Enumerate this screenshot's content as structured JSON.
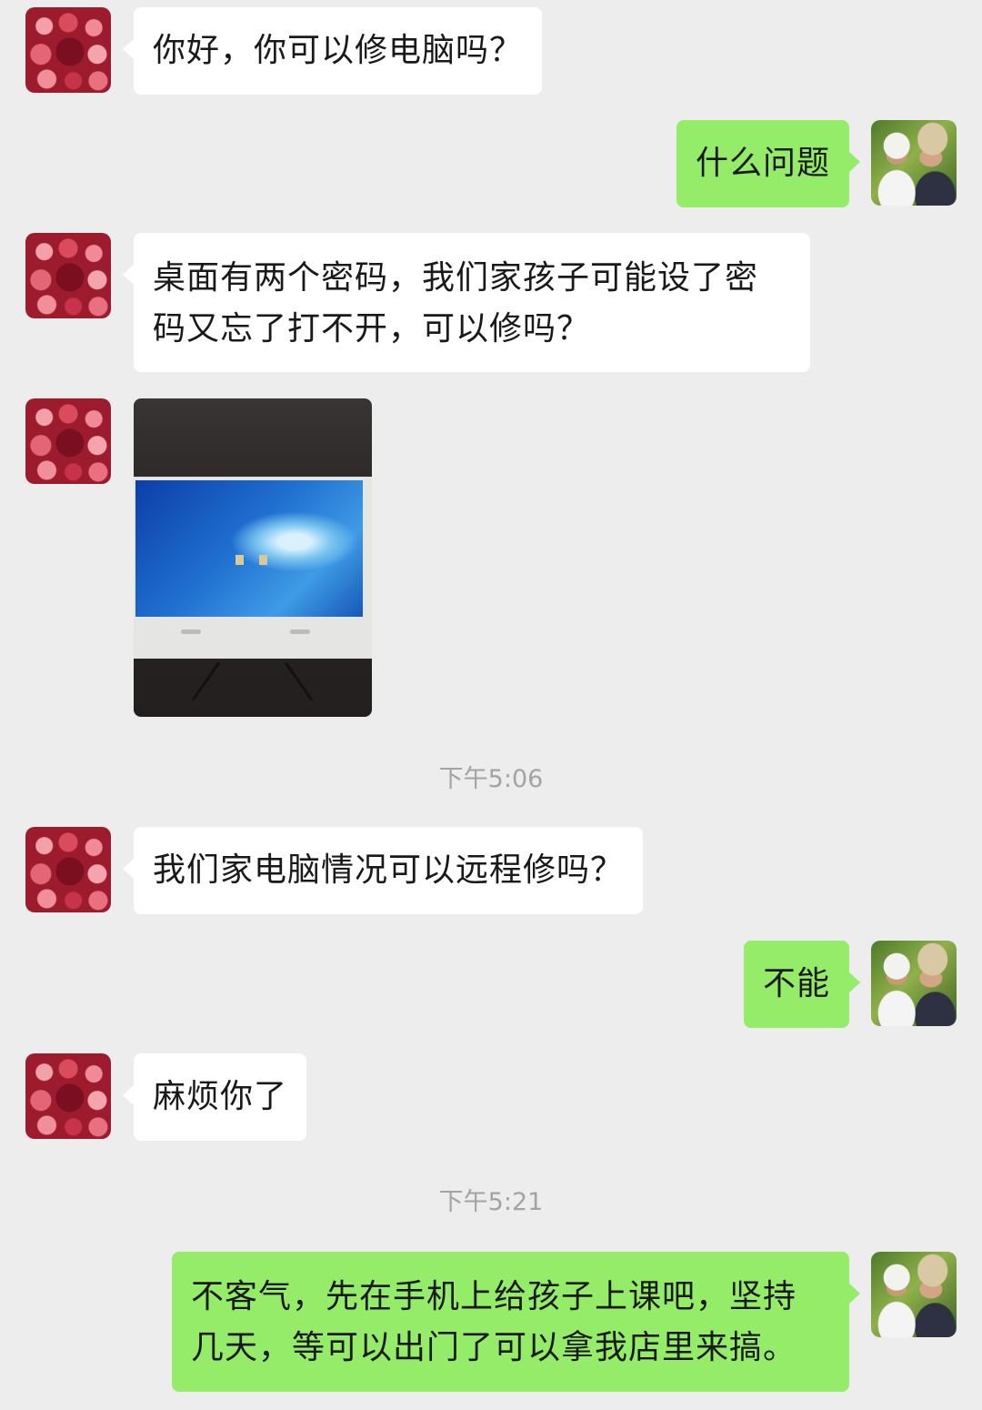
{
  "messages": [
    {
      "side": "in",
      "lines": [
        "你好，你可以修电脑吗？"
      ]
    },
    {
      "side": "out",
      "lines": [
        "什么问题"
      ]
    },
    {
      "side": "in",
      "lines": [
        "桌面有两个密码，我们家孩子可能设了密",
        "码又忘了打不开，可以修吗？"
      ]
    },
    {
      "side": "in",
      "type": "image",
      "image_desc": "photo of desktop computer screen"
    },
    {
      "type": "time",
      "text": "下午5:06"
    },
    {
      "side": "in",
      "lines": [
        "我们家电脑情况可以远程修吗？"
      ]
    },
    {
      "side": "out",
      "lines": [
        "不能"
      ]
    },
    {
      "side": "in",
      "lines": [
        "麻烦你了"
      ]
    },
    {
      "type": "time",
      "text": "下午5:21"
    },
    {
      "side": "out",
      "lines": [
        "不客气，先在手机上给孩子上课吧，坚持",
        "几天，等可以出门了可以拿我店里来搞。"
      ]
    }
  ],
  "colors": {
    "background": "#ededed",
    "incoming_bubble": "#ffffff",
    "outgoing_bubble": "#95ec69",
    "time_text": "#a3a3a3"
  },
  "avatars": {
    "incoming": "rose-avatar",
    "outgoing": "selfie-avatar"
  }
}
